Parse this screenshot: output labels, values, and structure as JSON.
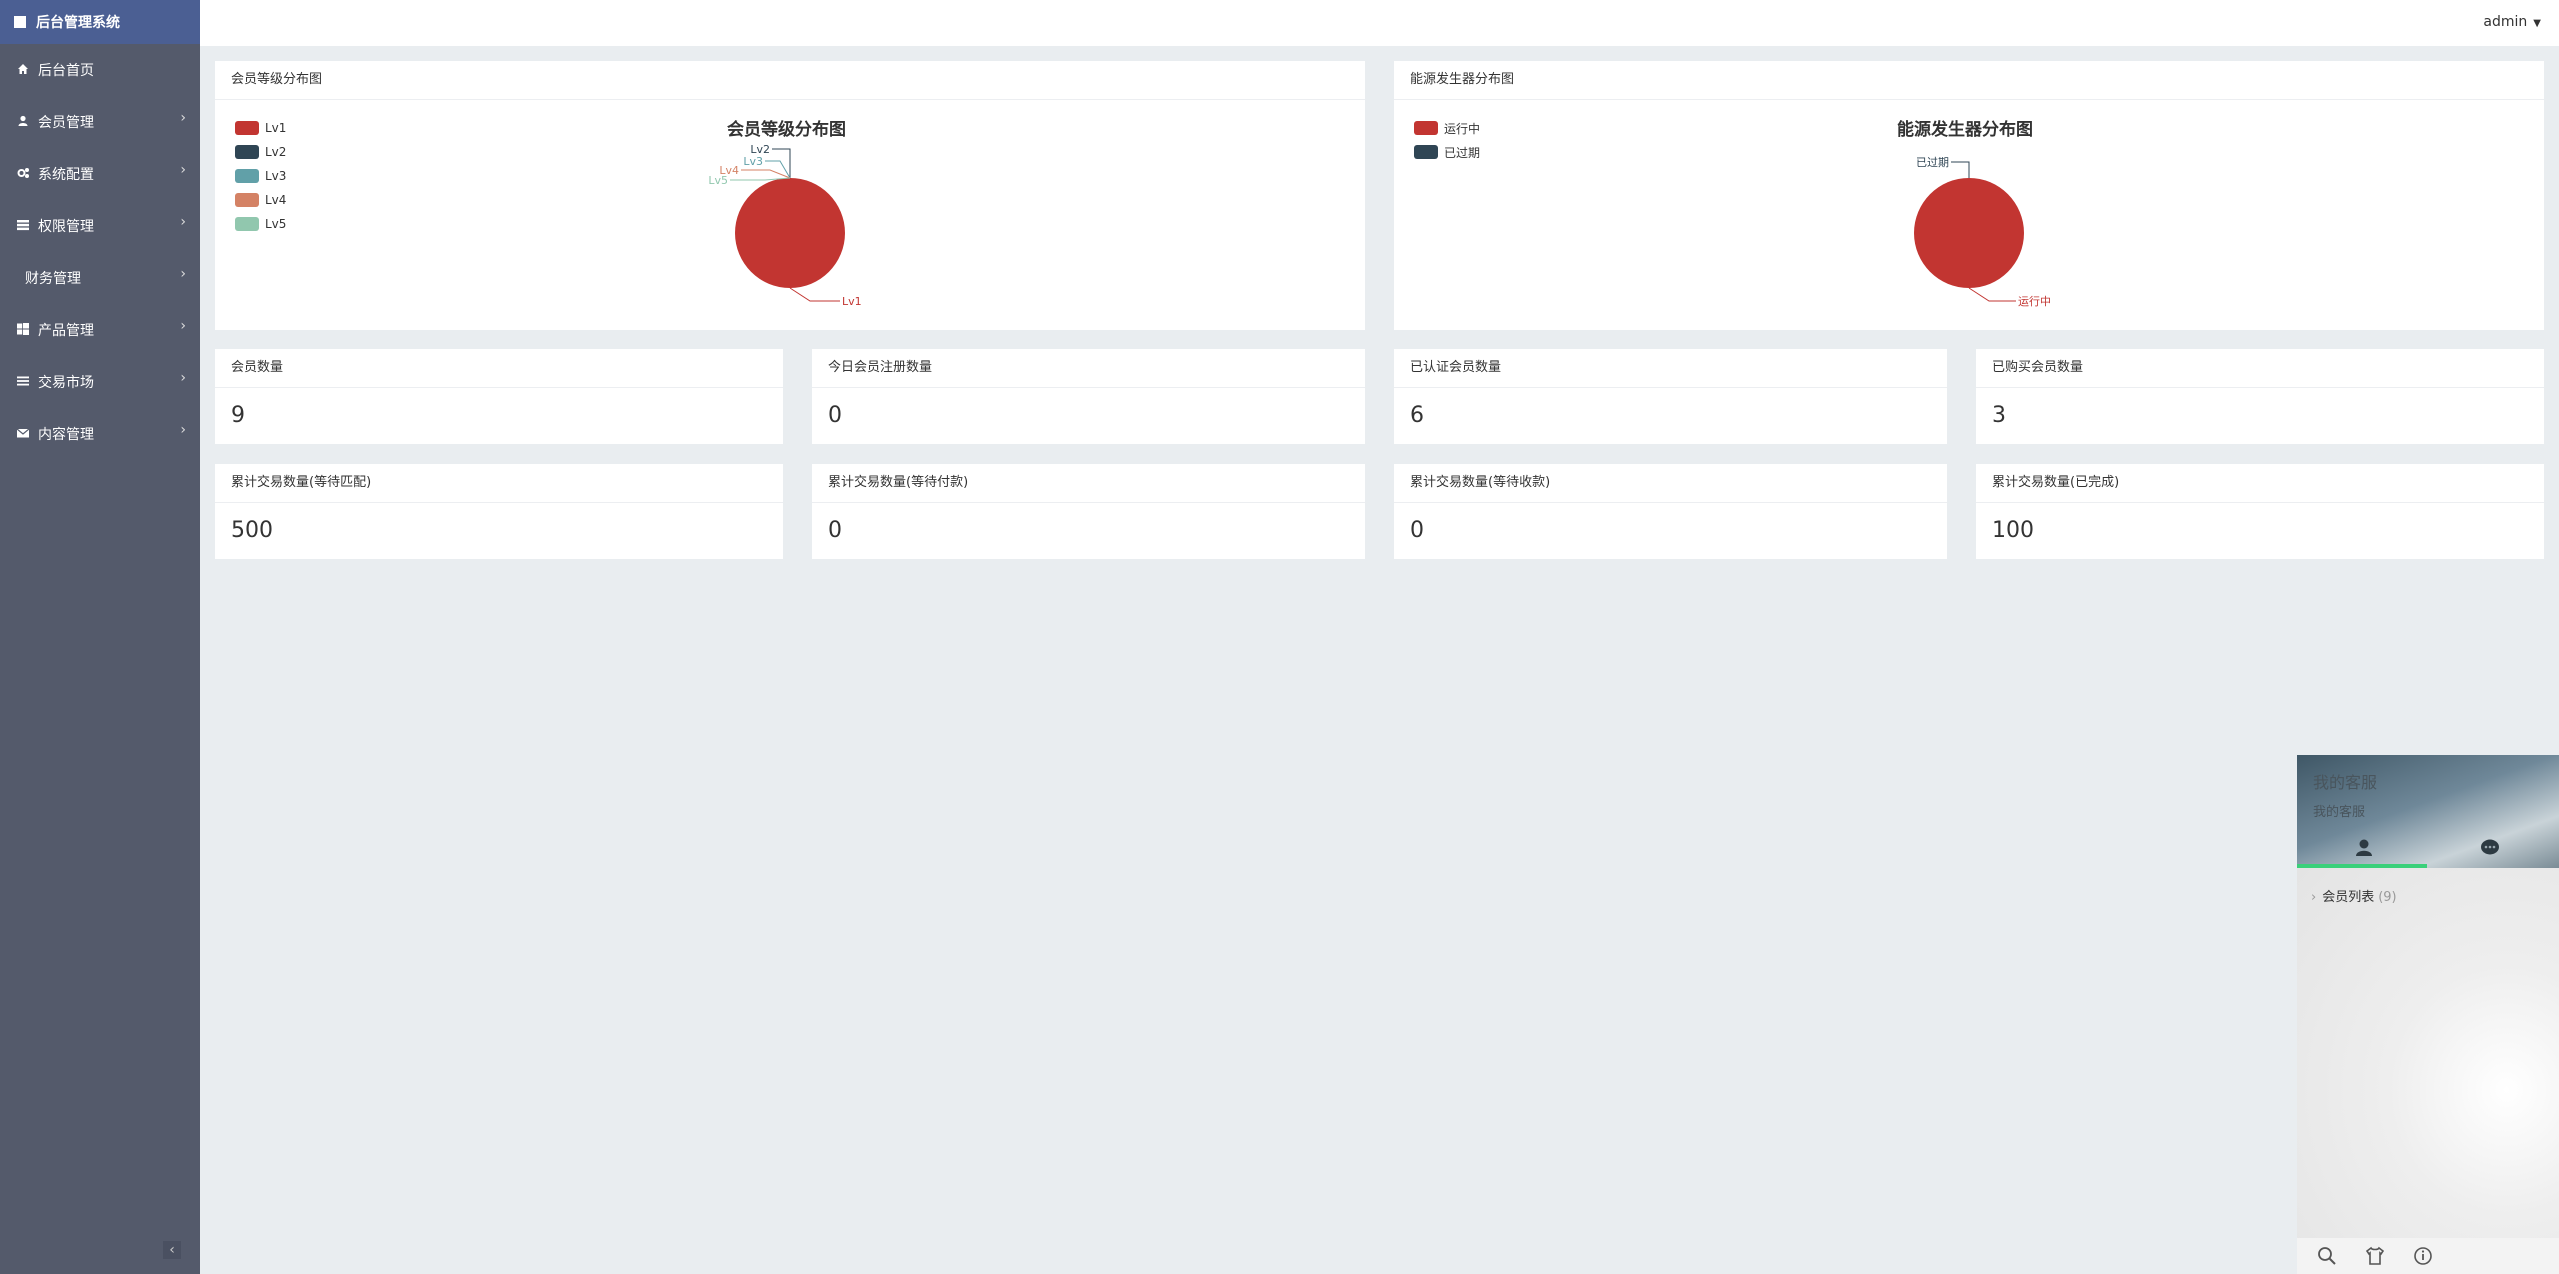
{
  "sidebar": {
    "brand": "后台管理系统",
    "items": [
      {
        "label": "后台首页",
        "icon": "home-icon",
        "chevron": false
      },
      {
        "label": "会员管理",
        "icon": "user-icon",
        "chevron": true
      },
      {
        "label": "系统配置",
        "icon": "cogs-icon",
        "chevron": true
      },
      {
        "label": "权限管理",
        "icon": "server-icon",
        "chevron": true
      },
      {
        "label": "财务管理",
        "icon": "",
        "chevron": true
      },
      {
        "label": "产品管理",
        "icon": "windows-icon",
        "chevron": true
      },
      {
        "label": "交易市场",
        "icon": "list-icon",
        "chevron": true
      },
      {
        "label": "内容管理",
        "icon": "envelope-icon",
        "chevron": true
      }
    ]
  },
  "topbar": {
    "user": "admin"
  },
  "charts": {
    "members": {
      "card_title": "会员等级分布图",
      "chart_data": {
        "type": "pie",
        "title": "会员等级分布图",
        "categories": [
          "Lv1",
          "Lv2",
          "Lv3",
          "Lv4",
          "Lv5"
        ],
        "values": [
          9,
          0,
          0,
          0,
          0
        ],
        "colors": [
          "#c23531",
          "#2f4554",
          "#61a0a8",
          "#d48265",
          "#91c7ae"
        ],
        "legend": "top-left"
      }
    },
    "generators": {
      "card_title": "能源发生器分布图",
      "chart_data": {
        "type": "pie",
        "title": "能源发生器分布图",
        "categories": [
          "运行中",
          "已过期"
        ],
        "values": [
          1,
          0
        ],
        "colors": [
          "#c23531",
          "#2f4554"
        ],
        "legend": "top-left"
      }
    }
  },
  "stats": [
    {
      "label": "会员数量",
      "value": "9"
    },
    {
      "label": "今日会员注册数量",
      "value": "0"
    },
    {
      "label": "已认证会员数量",
      "value": "6"
    },
    {
      "label": "已购买会员数量",
      "value": "3"
    },
    {
      "label": "累计交易数量(等待匹配)",
      "value": "500"
    },
    {
      "label": "累计交易数量(等待付款)",
      "value": "0"
    },
    {
      "label": "累计交易数量(等待收款)",
      "value": "0"
    },
    {
      "label": "累计交易数量(已完成)",
      "value": "100"
    }
  ],
  "chat": {
    "title": "我的客服",
    "subtitle": "我的客服",
    "member_list_label": "会员列表",
    "member_count": "(9)",
    "accent": "#3ad07a"
  }
}
